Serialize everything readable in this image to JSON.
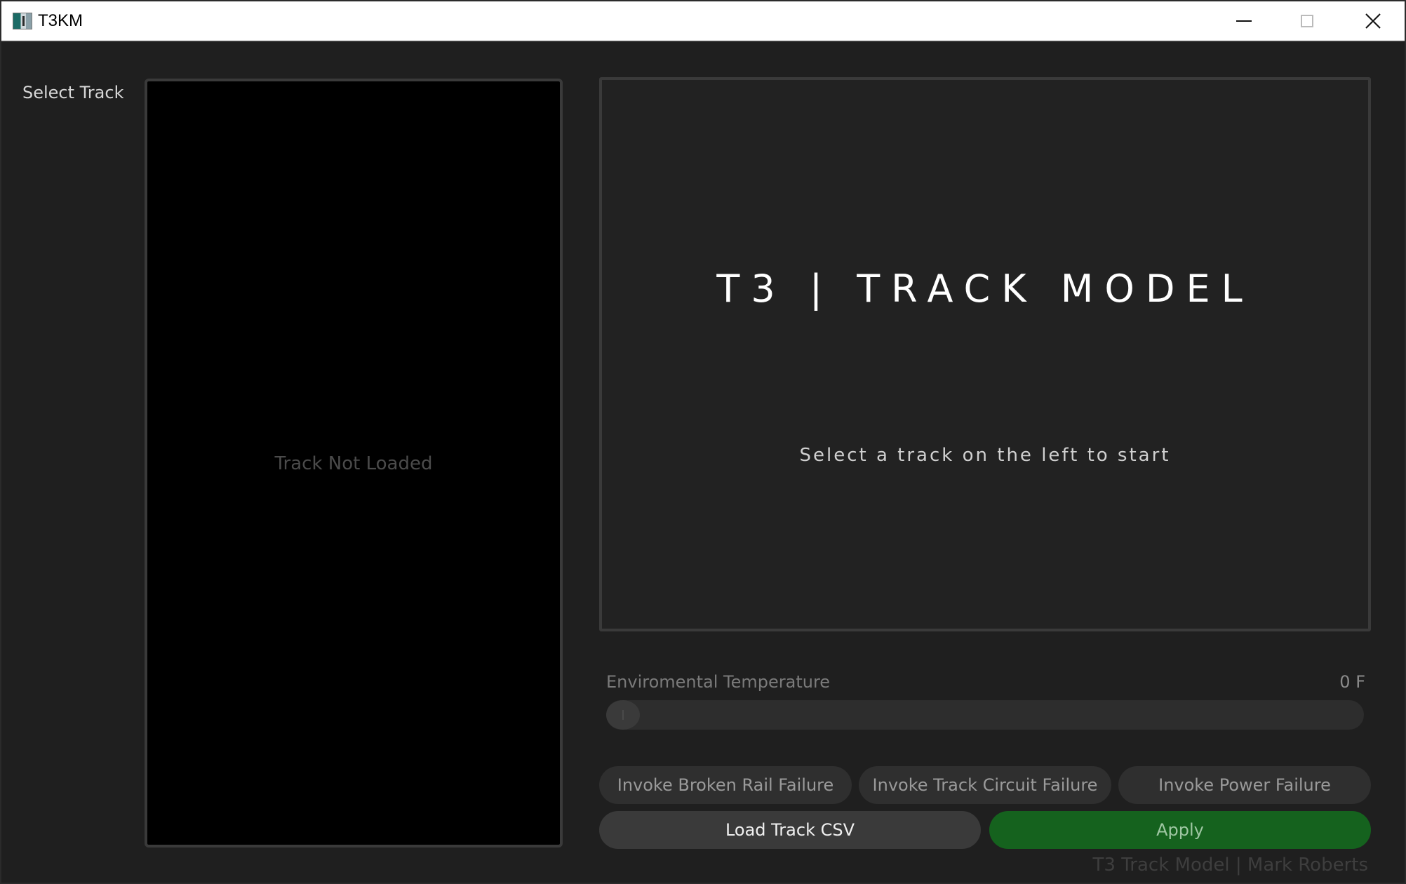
{
  "window": {
    "title": "T3KM"
  },
  "sidebar": {
    "select_track_label": "Select Track"
  },
  "track_panel": {
    "empty_text": "Track Not Loaded"
  },
  "main_display": {
    "title": "T3 | TRACK MODEL",
    "hint": "Select a track on the left to start"
  },
  "temperature": {
    "label": "Enviromental Temperature",
    "value_text": "0 F",
    "slider_fraction": 0
  },
  "buttons": {
    "broken_rail": "Invoke Broken Rail Failure",
    "track_circuit": "Invoke Track Circuit Failure",
    "power": "Invoke Power Failure",
    "load_csv": "Load Track CSV",
    "apply": "Apply"
  },
  "footer": {
    "text": "T3 Track Model | Mark Roberts"
  },
  "colors": {
    "background": "#1f1f1f",
    "apply_green": "#15621e"
  },
  "icons": {
    "app": "app-icon",
    "minimize": "minimize-icon",
    "maximize": "maximize-icon",
    "close": "close-icon"
  }
}
